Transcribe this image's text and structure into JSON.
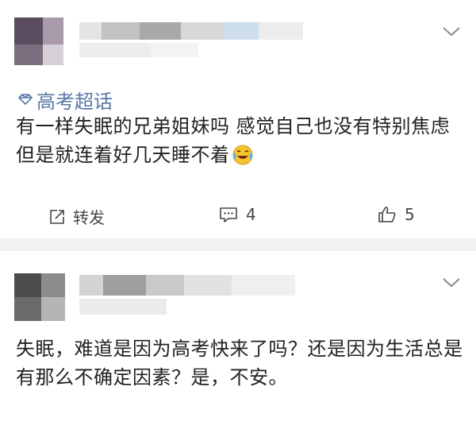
{
  "post1": {
    "topic": "高考超话",
    "text": "有一样失眠的兄弟姐妹吗 感觉自己也没有特别焦虑 但是就连着好几天睡不着",
    "actions": {
      "repost_label": "转发",
      "comment_count": "4",
      "like_count": "5"
    }
  },
  "post2": {
    "text": "失眠，难道是因为高考快来了吗？还是因为生活总是有那么不确定因素？是，不安。"
  },
  "icons": {
    "topic": "diamond-icon",
    "expand": "chevron-down-icon",
    "repost": "repost-icon",
    "comment": "comment-icon",
    "like": "thumbs-up-icon",
    "emoji": "laugh-cry-emoji-icon"
  },
  "colors": {
    "topic": "#5a77a6",
    "text": "#222222",
    "action": "#444444",
    "divider": "#f2f2f2"
  }
}
